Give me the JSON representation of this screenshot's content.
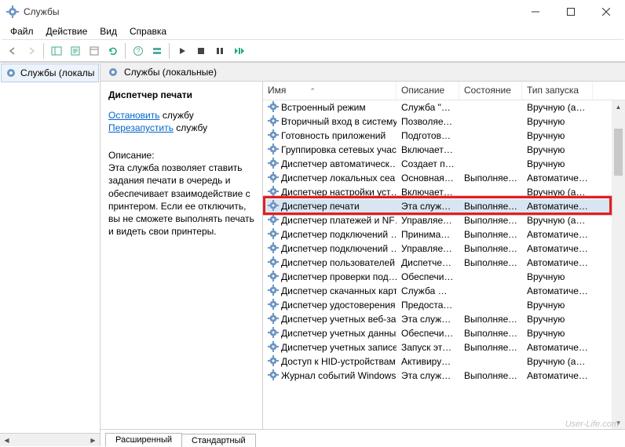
{
  "window": {
    "title": "Службы"
  },
  "menu": [
    "Файл",
    "Действие",
    "Вид",
    "Справка"
  ],
  "tree": {
    "root": "Службы (локалы"
  },
  "pane": {
    "header": "Службы (локальные)"
  },
  "info": {
    "title": "Диспетчер печати",
    "stop": "Остановить",
    "stop_suffix": " службу",
    "restart": "Перезапустить",
    "restart_suffix": " службу",
    "desc_label": "Описание:",
    "desc": "Эта служба позволяет ставить задания печати в очередь и обеспечивает взаимодействие с принтером. Если ее отключить, вы не сможете выполнять печать и видеть свои принтеры."
  },
  "columns": {
    "name": "Имя",
    "desc": "Описание",
    "state": "Состояние",
    "start": "Тип запуска"
  },
  "tabs": {
    "extended": "Расширенный",
    "standard": "Стандартный"
  },
  "watermark": "User-Life.com",
  "services": [
    {
      "name": "Встроенный режим",
      "desc": "Служба \"В…",
      "state": "",
      "start": "Вручную (ак…"
    },
    {
      "name": "Вторичный вход в систему",
      "desc": "Позволяет …",
      "state": "",
      "start": "Вручную"
    },
    {
      "name": "Готовность приложений",
      "desc": "Подготовк…",
      "state": "",
      "start": "Вручную"
    },
    {
      "name": "Группировка сетевых учас…",
      "desc": "Включает …",
      "state": "",
      "start": "Вручную"
    },
    {
      "name": "Диспетчер автоматическ…",
      "desc": "Создает п…",
      "state": "",
      "start": "Вручную"
    },
    {
      "name": "Диспетчер локальных сеа…",
      "desc": "Основная …",
      "state": "Выполняется",
      "start": "Автоматиче…"
    },
    {
      "name": "Диспетчер настройки уст…",
      "desc": "Включает …",
      "state": "",
      "start": "Вручную (ак…"
    },
    {
      "name": "Диспетчер печати",
      "desc": "Эта служб…",
      "state": "Выполняется",
      "start": "Автоматиче…",
      "selected": true
    },
    {
      "name": "Диспетчер платежей и NF…",
      "desc": "Управляет…",
      "state": "Выполняется",
      "start": "Вручную (ак…"
    },
    {
      "name": "Диспетчер подключений …",
      "desc": "Принимае…",
      "state": "Выполняется",
      "start": "Автоматиче…"
    },
    {
      "name": "Диспетчер подключений …",
      "desc": "Управляет…",
      "state": "Выполняется",
      "start": "Автоматиче…"
    },
    {
      "name": "Диспетчер пользователей",
      "desc": "Диспетчер…",
      "state": "Выполняется",
      "start": "Автоматиче…"
    },
    {
      "name": "Диспетчер проверки под…",
      "desc": "Обеспечи…",
      "state": "",
      "start": "Вручную"
    },
    {
      "name": "Диспетчер скачанных карт",
      "desc": "Служба W…",
      "state": "",
      "start": "Автоматиче…"
    },
    {
      "name": "Диспетчер удостоверения …",
      "desc": "Предостав…",
      "state": "",
      "start": "Вручную"
    },
    {
      "name": "Диспетчер учетных веб-за…",
      "desc": "Эта служб…",
      "state": "Выполняется",
      "start": "Вручную"
    },
    {
      "name": "Диспетчер учетных данных",
      "desc": "Обеспечи…",
      "state": "Выполняется",
      "start": "Вручную"
    },
    {
      "name": "Диспетчер учетных записе…",
      "desc": "Запуск это…",
      "state": "Выполняется",
      "start": "Автоматиче…"
    },
    {
      "name": "Доступ к HID-устройствам",
      "desc": "Активируе…",
      "state": "",
      "start": "Вручную (ак…"
    },
    {
      "name": "Журнал событий Windows",
      "desc": "Эта служб…",
      "state": "Выполняется",
      "start": "Автоматиче…"
    }
  ],
  "chart_data": null
}
